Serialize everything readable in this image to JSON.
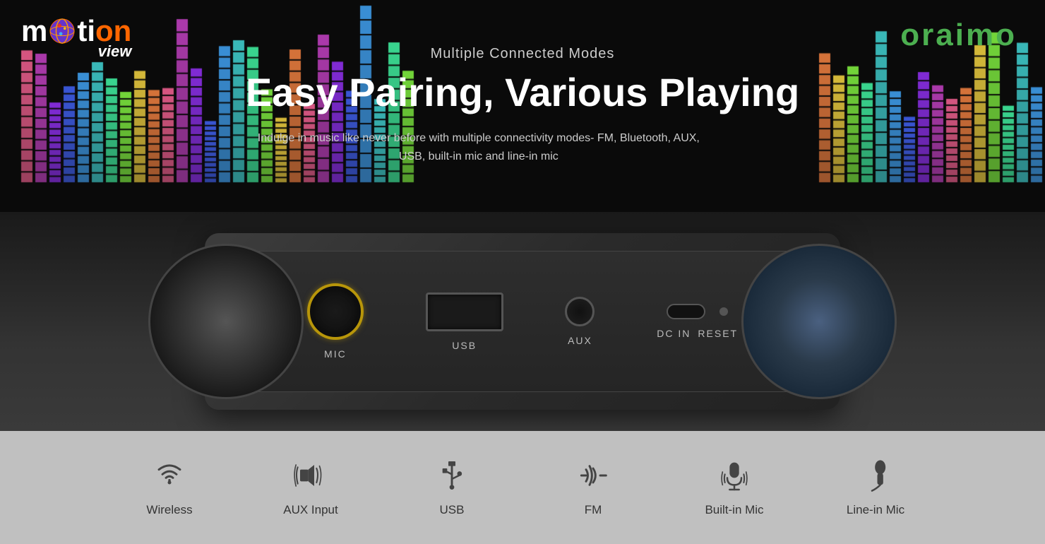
{
  "logo": {
    "brand": "motion",
    "sub": "view",
    "brand2": "oraimo"
  },
  "header": {
    "subtitle": "Multiple Connected Modes",
    "title": "Easy Pairing, Various Playing",
    "description": "Indulge in music like never before with multiple connectivity modes- FM, Bluetooth, AUX, USB, built-in mic and line-in mic"
  },
  "ports": [
    {
      "id": "mic",
      "label": "MIC"
    },
    {
      "id": "usb",
      "label": "USB"
    },
    {
      "id": "aux",
      "label": "AUX"
    },
    {
      "id": "dcin",
      "label": "DC IN"
    },
    {
      "id": "reset",
      "label": "RESET"
    }
  ],
  "connectivity": [
    {
      "id": "wireless",
      "label": "Wireless"
    },
    {
      "id": "aux-input",
      "label": "AUX Input"
    },
    {
      "id": "usb",
      "label": "USB"
    },
    {
      "id": "fm",
      "label": "FM"
    },
    {
      "id": "builtin-mic",
      "label": "Built-in Mic"
    },
    {
      "id": "linein-mic",
      "label": "Line-in Mic"
    }
  ]
}
